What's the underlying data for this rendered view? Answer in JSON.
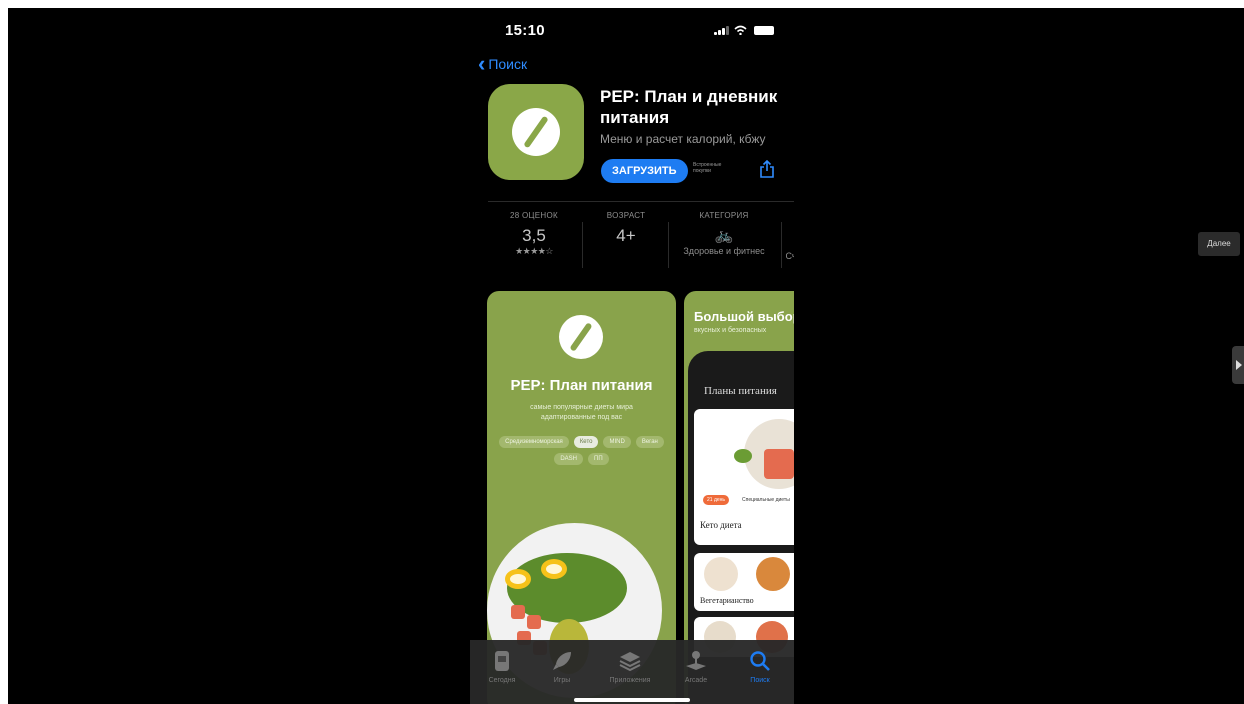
{
  "status_bar": {
    "time": "15:10"
  },
  "nav": {
    "back_label": "Поиск"
  },
  "app": {
    "title": "PEP: План и дневник питания",
    "subtitle": "Меню и расчет калорий, кбжу",
    "get_label": "ЗАГРУЗИТЬ",
    "iap_note": "Встроенные покупки",
    "icon_color": "#8aa748"
  },
  "stats": {
    "ratings": {
      "label": "28 ОЦЕНОК",
      "value": "3,5",
      "stars": "★★★★☆"
    },
    "age": {
      "label": "ВОЗРАСТ",
      "value": "4+"
    },
    "category": {
      "label": "КАТЕГОРИЯ",
      "icon": "bicycle-icon",
      "sub": "Здоровье и фитнес",
      "cut": "Сч"
    }
  },
  "screenshot1": {
    "title": "PEP: План питания",
    "desc": "самые популярные диеты мира адаптированные под вас",
    "chips": [
      "Средиземноморская",
      "Кето",
      "MIND",
      "Веган",
      "DASH",
      "ПП"
    ]
  },
  "screenshot2": {
    "title": "Большой выбор",
    "desc": "вкусных и безопасных",
    "header": "Планы питания",
    "tag1": "21 день",
    "tag2": "Специальные диеты",
    "card1": "Кето диета",
    "card2": "Вегетарианство"
  },
  "tabbar": {
    "tabs": [
      {
        "label": "Сегодня",
        "icon": "today-icon"
      },
      {
        "label": "Игры",
        "icon": "rocket-icon"
      },
      {
        "label": "Приложения",
        "icon": "layers-icon"
      },
      {
        "label": "Arcade",
        "icon": "joystick-icon"
      },
      {
        "label": "Поиск",
        "icon": "search-icon"
      }
    ],
    "active_color": "#1e7cf2"
  },
  "overlay": {
    "next_label": "Далее"
  }
}
